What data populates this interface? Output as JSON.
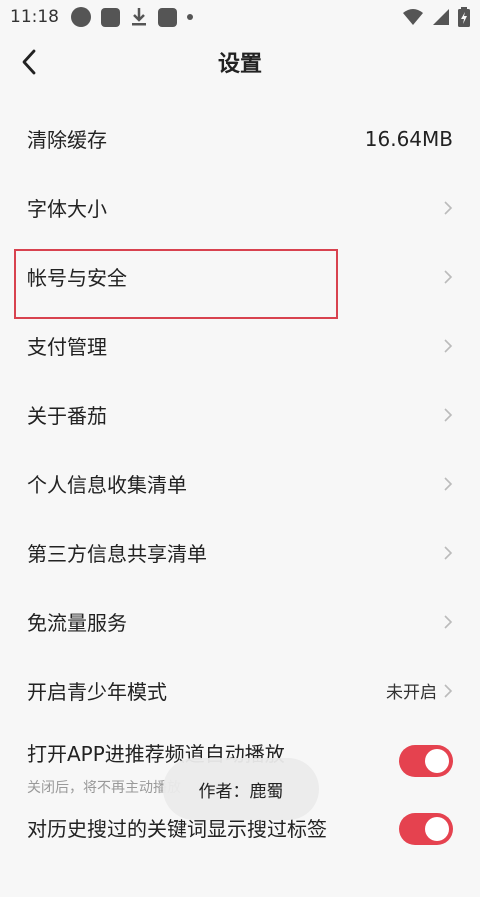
{
  "status_bar": {
    "time": "11:18",
    "left_icons": [
      "circle-icon",
      "square-icon",
      "download-icon",
      "square-icon",
      "dot-icon"
    ],
    "right_icons": [
      "wifi-icon",
      "signal-icon",
      "battery-charging-icon"
    ]
  },
  "header": {
    "title": "设置",
    "back_icon": "chevron-left-icon"
  },
  "settings": {
    "items": [
      {
        "label": "清除缓存",
        "value": "16.64MB"
      },
      {
        "label": "字体大小"
      },
      {
        "label": "帐号与安全"
      },
      {
        "label": "支付管理"
      },
      {
        "label": "关于番茄"
      },
      {
        "label": "个人信息收集清单"
      },
      {
        "label": "第三方信息共享清单"
      },
      {
        "label": "免流量服务"
      },
      {
        "label": "开启青少年模式",
        "value": "未开启"
      }
    ],
    "autoplay": {
      "label": "打开APP进推荐频道自动播放",
      "sub": "关闭后，将不再主动播放",
      "enabled": true
    },
    "search_tag": {
      "label": "对历史搜过的关键词显示搜过标签",
      "enabled": true
    }
  },
  "toast": {
    "text": "作者：鹿蜀"
  },
  "colors": {
    "accent": "#e5424f",
    "highlight_border": "#d8424f"
  }
}
